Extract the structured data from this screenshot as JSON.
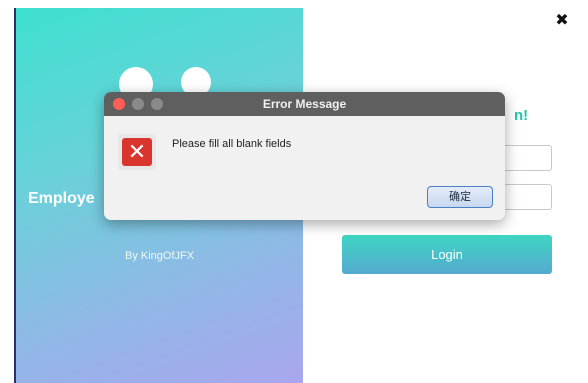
{
  "background_window": {
    "brand_title": "Employe",
    "author": "By KingOfJFX",
    "welcome_partial": "n!",
    "username_value": "",
    "password_value": "",
    "login_label": "Login",
    "close_label": "✖"
  },
  "dialog": {
    "title": "Error Message",
    "message": "Please fill all blank fields",
    "ok_label": "确定",
    "icon": "error-x-icon"
  },
  "colors": {
    "accent_teal": "#3ee0cf",
    "dialog_titlebar": "#5f5f5f",
    "error_red": "#d9352e",
    "ok_button_border": "#4a7fc4"
  }
}
